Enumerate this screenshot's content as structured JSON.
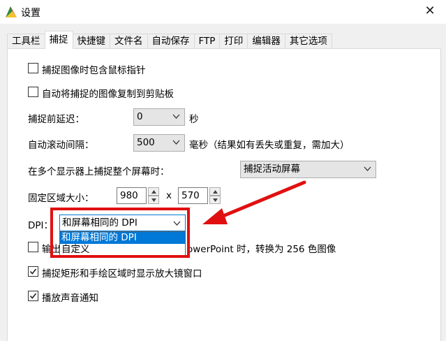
{
  "window": {
    "title": "设置",
    "close_glyph": "✕"
  },
  "tabs": [
    "工具栏",
    "捕捉",
    "快捷键",
    "文件名",
    "自动保存",
    "FTP",
    "打印",
    "编辑器",
    "其它选项"
  ],
  "active_tab_index": 1,
  "options": {
    "include_cursor": {
      "label": "捕捉图像时包含鼠标指针",
      "checked": false
    },
    "copy_to_clipboard": {
      "label": "自动将捕捉的图像复制到剪贴板",
      "checked": false
    },
    "capture_delay": {
      "label": "捕捉前延迟：",
      "value": "0",
      "unit": "秒"
    },
    "auto_scroll_interval": {
      "label": "自动滚动间隔：",
      "value": "500",
      "unit": "毫秒（结果如有丢失或重复，需加大）"
    },
    "multi_monitor": {
      "label": "在多个显示器上捕捉整个屏幕时：",
      "value": "捕捉活动屏幕"
    },
    "fixed_region": {
      "label": "固定区域大小：",
      "width": "980",
      "times": "x",
      "height": "570"
    },
    "dpi": {
      "label": "DPI：",
      "value": "和屏幕相同的 DPI",
      "options": [
        "和屏幕相同的 DPI",
        "自定义"
      ],
      "selected_index": 0
    },
    "output_ppt": {
      "label_prefix": "输出",
      "label_suffix": "owerPoint 时，转换为 256 色图像",
      "checked": false
    },
    "magnifier": {
      "label": "捕捉矩形和手绘区域时显示放大镜窗口",
      "checked": true
    },
    "sound": {
      "label": "播放声音通知",
      "checked": true
    }
  },
  "colors": {
    "highlight": "#e01010",
    "arrow": "#e01010",
    "accent": "#0078d7"
  },
  "icons": {
    "app": "app-logo-icon",
    "close": "close-icon",
    "chevron": "chevron-down-icon",
    "check": "checkmark-icon"
  }
}
